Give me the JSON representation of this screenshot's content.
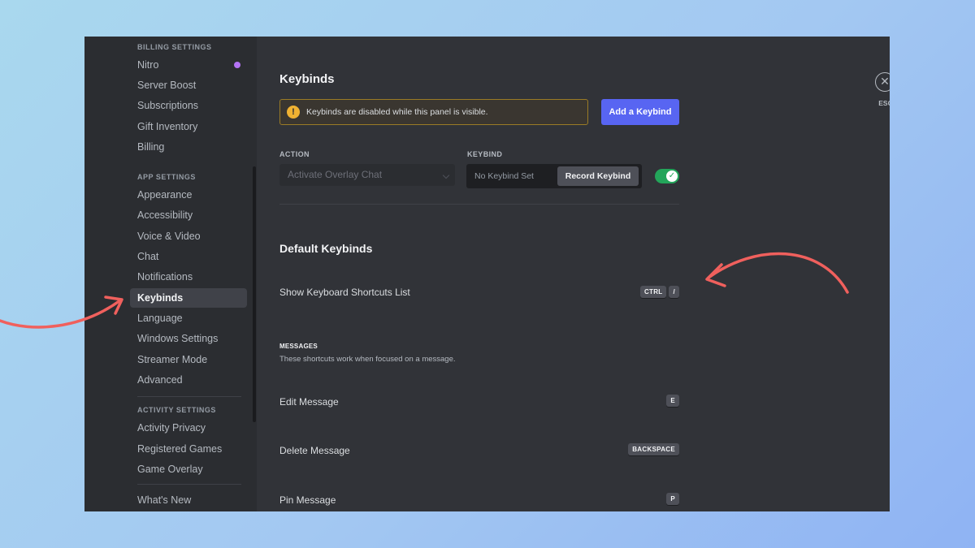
{
  "sidebar": {
    "billing_header": "BILLING SETTINGS",
    "billing_items": [
      "Nitro",
      "Server Boost",
      "Subscriptions",
      "Gift Inventory",
      "Billing"
    ],
    "app_header": "APP SETTINGS",
    "app_items": [
      "Appearance",
      "Accessibility",
      "Voice & Video",
      "Chat",
      "Notifications",
      "Keybinds",
      "Language",
      "Windows Settings",
      "Streamer Mode",
      "Advanced"
    ],
    "active_item": "Keybinds",
    "activity_header": "ACTIVITY SETTINGS",
    "activity_items": [
      "Activity Privacy",
      "Registered Games",
      "Game Overlay"
    ],
    "whats_new": "What's New"
  },
  "main": {
    "title": "Keybinds",
    "notice_text": "Keybinds are disabled while this panel is visible.",
    "add_button": "Add a Keybind",
    "action_label": "ACTION",
    "keybind_label": "KEYBIND",
    "action_value": "Activate Overlay Chat",
    "keybind_value": "No Keybind Set",
    "record_button": "Record Keybind",
    "toggle_enabled": true,
    "default_title": "Default Keybinds",
    "show_shortcuts": {
      "label": "Show Keyboard Shortcuts List",
      "keys": [
        "CTRL",
        "/"
      ]
    },
    "messages_header": "MESSAGES",
    "messages_sub": "These shortcuts work when focused on a message.",
    "edit_message": {
      "label": "Edit Message",
      "keys": [
        "E"
      ]
    },
    "delete_message": {
      "label": "Delete Message",
      "keys": [
        "BACKSPACE"
      ]
    },
    "pin_message": {
      "label": "Pin Message",
      "keys": [
        "P"
      ]
    }
  },
  "close": {
    "icon": "close-icon",
    "label": "ESC"
  },
  "colors": {
    "accent": "#5865f2",
    "toggle_on": "#23a55a",
    "arrow": "#f0605d",
    "warning": "#f0b232"
  }
}
